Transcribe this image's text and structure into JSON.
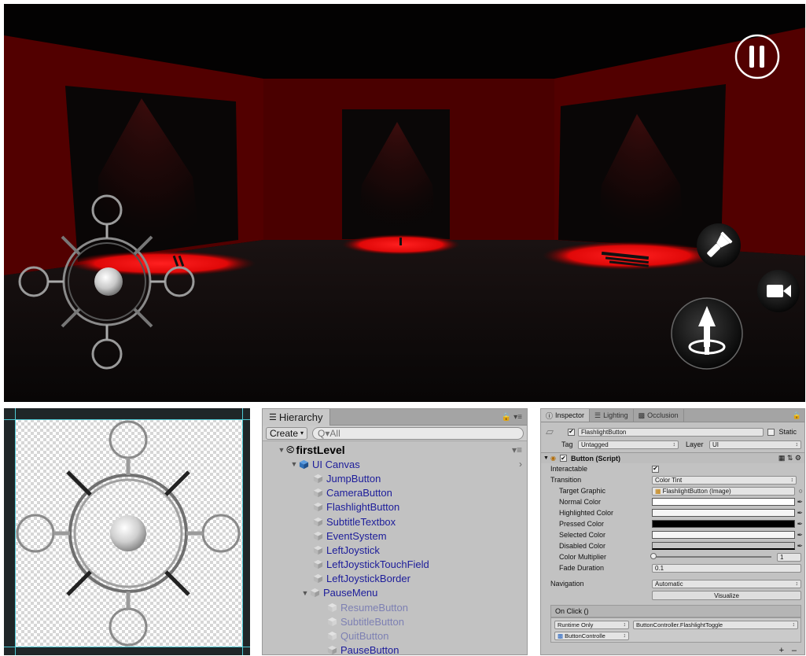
{
  "hierarchy": {
    "tab_title": "Hierarchy",
    "tab_icons": "🔒 ▾≡",
    "create_label": "Create",
    "search_placeholder": "Q▾All",
    "scene_name": "firstLevel",
    "items": [
      {
        "label": "UI Canvas",
        "depth": 1,
        "expanded": true,
        "disabled": false
      },
      {
        "label": "JumpButton",
        "depth": 2,
        "expanded": null,
        "disabled": false
      },
      {
        "label": "CameraButton",
        "depth": 2,
        "expanded": null,
        "disabled": false
      },
      {
        "label": "FlashlightButton",
        "depth": 2,
        "expanded": null,
        "disabled": false
      },
      {
        "label": "SubtitleTextbox",
        "depth": 2,
        "expanded": null,
        "disabled": false
      },
      {
        "label": "EventSystem",
        "depth": 2,
        "expanded": null,
        "disabled": false
      },
      {
        "label": "LeftJoystick",
        "depth": 2,
        "expanded": null,
        "disabled": false
      },
      {
        "label": "LeftJoystickTouchField",
        "depth": 2,
        "expanded": null,
        "disabled": false
      },
      {
        "label": "LeftJoystickBorder",
        "depth": 2,
        "expanded": null,
        "disabled": false
      },
      {
        "label": "PauseMenu",
        "depth": 2,
        "expanded": true,
        "disabled": false
      },
      {
        "label": "ResumeButton",
        "depth": 3,
        "expanded": null,
        "disabled": true
      },
      {
        "label": "SubtitleButton",
        "depth": 3,
        "expanded": null,
        "disabled": true
      },
      {
        "label": "QuitButton",
        "depth": 3,
        "expanded": null,
        "disabled": true
      },
      {
        "label": "PauseButton",
        "depth": 3,
        "expanded": null,
        "disabled": false
      }
    ]
  },
  "inspector": {
    "tabs": [
      "Inspector",
      "Lighting",
      "Occlusion"
    ],
    "object_name": "FlashlightButton",
    "static_label": "Static",
    "tag_label": "Tag",
    "tag_value": "Untagged",
    "layer_label": "Layer",
    "layer_value": "UI",
    "component_title": "Button (Script)",
    "interactable_label": "Interactable",
    "interactable_checked": "✔",
    "transition_label": "Transition",
    "transition_value": "Color Tint",
    "target_graphic_label": "Target Graphic",
    "target_graphic_value": "FlashlightButton (Image)",
    "normal_color_label": "Normal Color",
    "highlighted_color_label": "Highlighted Color",
    "pressed_color_label": "Pressed Color",
    "selected_color_label": "Selected Color",
    "disabled_color_label": "Disabled Color",
    "color_multiplier_label": "Color Multiplier",
    "color_multiplier_value": "1",
    "fade_duration_label": "Fade Duration",
    "fade_duration_value": "0.1",
    "navigation_label": "Navigation",
    "navigation_value": "Automatic",
    "visualize_label": "Visualize",
    "onclick_label": "On Click ()",
    "runtime_value": "Runtime Only",
    "function_value": "ButtonController.FlashlightToggle",
    "object_ref_value": "ButtonControlle",
    "colors": {
      "normal": "#ffffff",
      "highlighted": "#f5f5f5",
      "pressed": "#000000",
      "selected": "#f5f5f5",
      "disabled": "#c8c8c8"
    }
  },
  "game": {
    "pause_icon": "pause-icon",
    "flashlight_icon": "flashlight-icon",
    "camera_icon": "camera-icon",
    "jump_icon": "jump-icon",
    "wall_color": "#5a0000",
    "light_color": "#ff1010"
  }
}
